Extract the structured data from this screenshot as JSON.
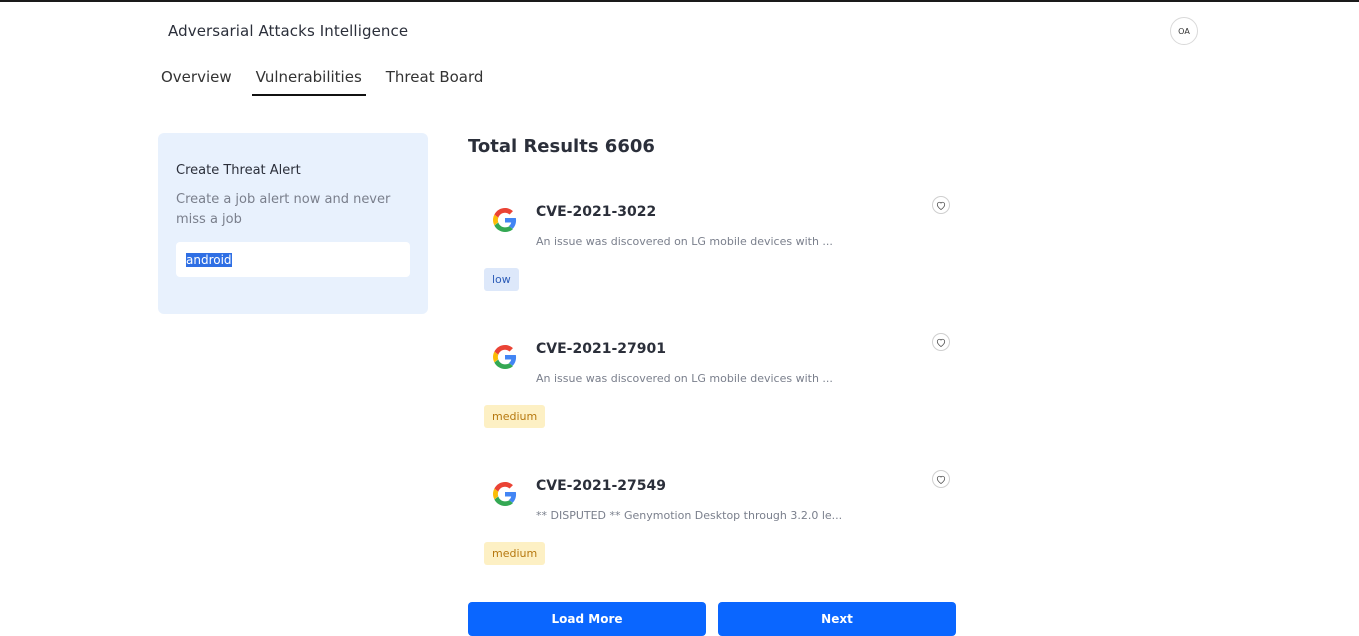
{
  "header": {
    "app_title": "Adversarial Attacks Intelligence",
    "avatar_initials": "OA"
  },
  "tabs": [
    {
      "label": "Overview",
      "active": false
    },
    {
      "label": "Vulnerabilities",
      "active": true
    },
    {
      "label": "Threat Board",
      "active": false
    }
  ],
  "alert_card": {
    "title": "Create Threat Alert",
    "description": "Create a job alert now and never miss a job",
    "input_value": "android"
  },
  "results": {
    "title": "Total Results 6606",
    "items": [
      {
        "cve": "CVE-2021-3022",
        "description": "An issue was discovered on LG mobile devices with ...",
        "severity": "low",
        "icon": "google-logo-icon"
      },
      {
        "cve": "CVE-2021-27901",
        "description": "An issue was discovered on LG mobile devices with ...",
        "severity": "medium",
        "icon": "google-logo-icon"
      },
      {
        "cve": "CVE-2021-27549",
        "description": "** DISPUTED ** Genymotion Desktop through 3.2.0 le...",
        "severity": "medium",
        "icon": "google-logo-icon"
      }
    ]
  },
  "buttons": {
    "load_more": "Load More",
    "next": "Next"
  },
  "colors": {
    "primary_button": "#0a66ff",
    "alert_card_bg": "#e8f1fd",
    "badge_low_bg": "#dde8fa",
    "badge_medium_bg": "#fdf0c4"
  }
}
